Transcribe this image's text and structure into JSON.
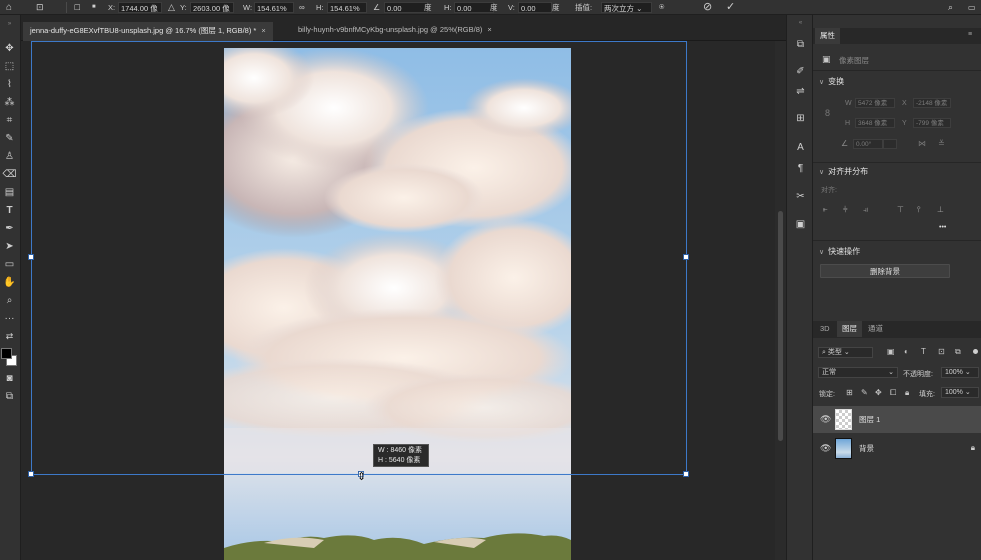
{
  "options_bar": {
    "x_label": "X:",
    "x_value": "1744.00 像",
    "y_label": "Y:",
    "y_value": "2603.00 像",
    "w_label": "W:",
    "w_value": "154.61%",
    "h_label": "H:",
    "h_value": "154.61%",
    "angle_value": "0.00",
    "angle_unit": "度",
    "skew_h_label": "H:",
    "skew_h_value": "0.00",
    "skew_h_unit": "度",
    "skew_v_label": "V:",
    "skew_v_value": "0.00",
    "skew_v_unit": "度",
    "interp_label": "插值:",
    "interp_value": "两次立方"
  },
  "tabs": [
    {
      "label": "jenna-duffy-eG8EXvfTBU8-unsplash.jpg @ 16.7% (图层 1, RGB/8) *",
      "close": "×",
      "active": true
    },
    {
      "label": "billy-huynh-v9bnfMCyKbg-unsplash.jpg @ 25%(RGB/8)",
      "close": "×",
      "active": false
    }
  ],
  "canvas": {
    "tooltip_w": "W : 8460 像素",
    "tooltip_h": "H : 5640 像素"
  },
  "right_panel": {
    "properties_tab": "属性",
    "pixel_layer_label": "像素图层",
    "transform_header": "变换",
    "t_w_label": "W",
    "t_w_value": "5472 像素",
    "t_x_label": "X",
    "t_x_value": "-2148 像素",
    "t_h_label": "H",
    "t_h_value": "3648 像素",
    "t_y_label": "Y",
    "t_y_value": "-799 像素",
    "t_angle_value": "0.00°",
    "align_header": "对齐并分布",
    "align_label": "对齐:",
    "more": "•••",
    "quick_header": "快速操作",
    "remove_bg_button": "删除背景",
    "layers_tabs": [
      "3D",
      "图层",
      "通道"
    ],
    "search_kind": "类型",
    "blend_mode": "正常",
    "opacity_label": "不透明度:",
    "opacity_value": "100%",
    "lock_label": "锁定:",
    "fill_label": "填充:",
    "fill_value": "100%",
    "layers": [
      {
        "name": "图层 1",
        "selected": true,
        "locked": false
      },
      {
        "name": "背景",
        "selected": false,
        "locked": true
      }
    ]
  },
  "colors": {
    "selection_accent": "#3d79c9",
    "panel_bg": "#323232",
    "canvas_bg": "#282828",
    "foreground_swatch": "#000000",
    "background_swatch": "#ffffff"
  }
}
